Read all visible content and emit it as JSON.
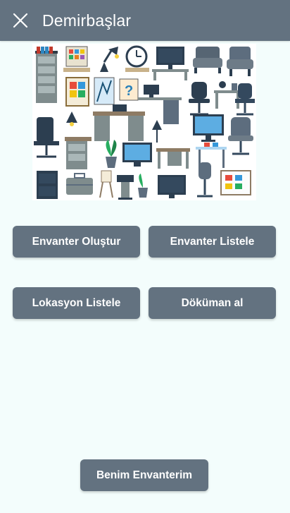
{
  "app_bar": {
    "title": "Demirbaşlar",
    "close_icon": "close-icon"
  },
  "actions": {
    "create_inventory": "Envanter Oluştur",
    "list_inventory": "Envanter Listele",
    "list_locations": "Lokasyon Listele",
    "get_document": "Döküman al",
    "my_inventory": "Benim Envanterim"
  },
  "colors": {
    "primary": "#637280",
    "background": "#f3fdfc",
    "on_primary": "#ffffff"
  }
}
